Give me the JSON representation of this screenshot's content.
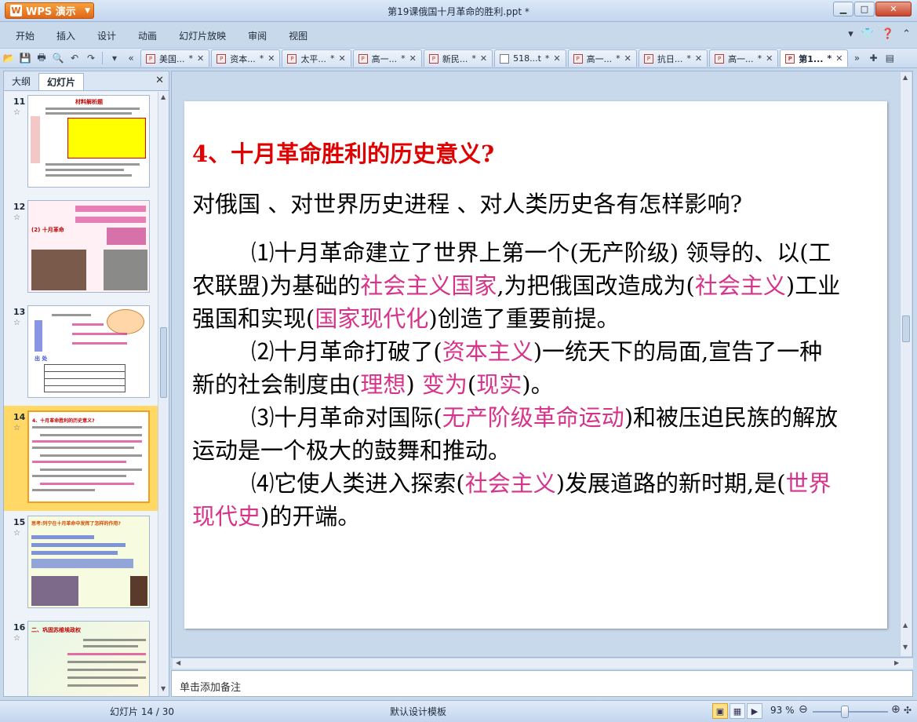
{
  "app": {
    "menu_label": "WPS 演示",
    "logo_letter": "W",
    "window_title": "第19课俄国十月革命的胜利.ppt *"
  },
  "menu": [
    "开始",
    "插入",
    "设计",
    "动画",
    "幻灯片放映",
    "审阅",
    "视图"
  ],
  "doc_tabs": [
    "美国...",
    "资本...",
    "太平...",
    "高一...",
    "新民...",
    "518...t",
    "高一...",
    "抗日...",
    "高一...",
    "第1..."
  ],
  "doc_tab_modified": "*",
  "panel": {
    "tab_outline": "大纲",
    "tab_slides": "幻灯片"
  },
  "thumbnails": [
    {
      "num": "11",
      "title": "材料解析题"
    },
    {
      "num": "12",
      "title": "(2) 十月革命"
    },
    {
      "num": "13",
      "title": "出  处"
    },
    {
      "num": "14",
      "title": "4、十月革命胜利的历史意义?"
    },
    {
      "num": "15",
      "title": "思考:列宁在十月革命中发挥了怎样的作用?"
    },
    {
      "num": "16",
      "title": "二、巩固苏维埃政权"
    }
  ],
  "slide": {
    "heading": "4、十月革命胜利的历史意义?",
    "question": "对俄国 、对世界历史进程 、对人类历史各有怎样影响?",
    "p1": {
      "t1": "⑴十月革命建立了世界上第一个(无产阶级) 领导的、以(工农联盟)为基础的",
      "h1": "社会主义国家",
      "t2": ",为把俄国改造成为(",
      "h2": "社会主义",
      "t3": ")工业强国和实现(",
      "h3": "国家现代化",
      "t4": ")创造了重要前提。"
    },
    "p2": {
      "t1": "⑵十月革命打破了(",
      "h1": "资本主义",
      "t2": ")一统天下的局面,宣告了一种新的社会制度由(",
      "h2": "理想",
      "t3": ") ",
      "h3": "变为",
      "t4": "(",
      "h4": "现实",
      "t5": ")。"
    },
    "p3": {
      "t1": "⑶十月革命对国际(",
      "h1": "无产阶级革命运动",
      "t2": ")和被压迫民族的解放运动是一个极大的鼓舞和推动。"
    },
    "p4": {
      "t1": "⑷它使人类进入探索(",
      "h1": "社会主义",
      "t2": ")发展道路的新时期,是(",
      "h2": "世界现代史",
      "t3": ")的开端。"
    }
  },
  "notes_placeholder": "单击添加备注",
  "status": {
    "slide_counter": "幻灯片 14 / 30",
    "template": "默认设计模板",
    "zoom": "93 %"
  },
  "colors": {
    "heading_red": "#e00000",
    "highlight_pink": "#d6338a",
    "selected_thumb": "#ffd866"
  }
}
